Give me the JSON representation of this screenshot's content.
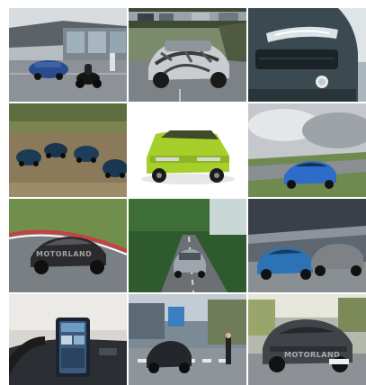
{
  "gallery": {
    "rows": 4,
    "columns": 3,
    "tiles": [
      {
        "subject": "blue sedan and motorcycle outside glass dealership",
        "colors": {
          "main": "#2a4c8c",
          "bg": "#9aa5ae"
        }
      },
      {
        "subject": "camouflaged prototype crossover on road",
        "colors": {
          "main": "#c9ccd1",
          "bg": "#4f5a40"
        }
      },
      {
        "subject": "dark SUV front headlight close-up",
        "colors": {
          "main": "#3a4a50",
          "bg": "#8fa1a8"
        }
      },
      {
        "subject": "four dark blue hatchbacks on gravel field",
        "colors": {
          "main": "#1c3b55",
          "bg": "#8b7a5a"
        }
      },
      {
        "subject": "lime green classic hatchback",
        "colors": {
          "main": "#a6cf2c",
          "bg": "#ffffff"
        }
      },
      {
        "subject": "blue sports car on track under cloudy sky",
        "colors": {
          "main": "#2d6cc9",
          "bg": "#6e8a4e"
        }
      },
      {
        "subject": "black coupe on racetrack corner",
        "colors": {
          "main": "#2b2b2e",
          "bg": "#6f8f4a"
        }
      },
      {
        "subject": "silver sedan on forest road",
        "colors": {
          "main": "#9ea6ad",
          "bg": "#2f5a2e"
        }
      },
      {
        "subject": "blue and grey coupes under gantry",
        "colors": {
          "main": "#2b73b5",
          "bg": "#5e6670"
        }
      },
      {
        "subject": "car interior with vertical touchscreen",
        "colors": {
          "main": "#1b2330",
          "bg": "#d9d6d2"
        }
      },
      {
        "subject": "dark SUV at city street crossing",
        "colors": {
          "main": "#23262b",
          "bg": "#7c8a95"
        }
      },
      {
        "subject": "dark grey crossover on sunny street",
        "colors": {
          "main": "#3f4449",
          "bg": "#9aa56c"
        }
      }
    ]
  }
}
